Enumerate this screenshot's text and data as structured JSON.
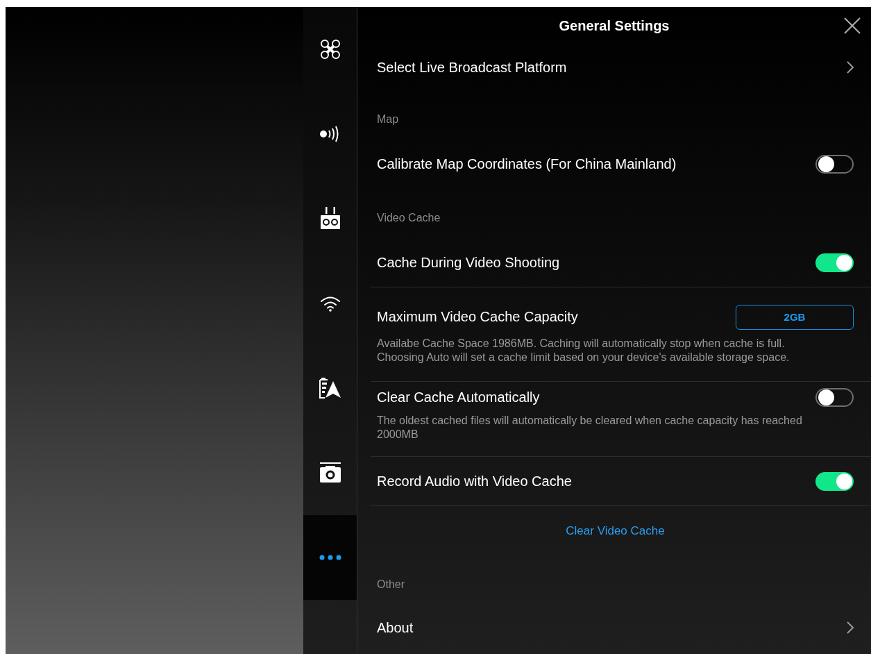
{
  "sidebar": {
    "items": [
      {
        "kind": "drone",
        "selected": false
      },
      {
        "kind": "transmission",
        "selected": false
      },
      {
        "kind": "controller",
        "selected": false
      },
      {
        "kind": "wifi",
        "selected": false
      },
      {
        "kind": "battery",
        "selected": false
      },
      {
        "kind": "camera",
        "selected": false
      },
      {
        "kind": "more",
        "selected": true
      }
    ]
  },
  "panel": {
    "title": "General Settings",
    "rows": [
      {
        "kind": "link",
        "label": "Select Live Broadcast Platform"
      },
      {
        "kind": "section",
        "label": "Map"
      },
      {
        "kind": "toggle",
        "label": "Calibrate Map Coordinates (For China Mainland)",
        "on": false
      },
      {
        "kind": "section",
        "label": "Video Cache"
      },
      {
        "kind": "toggle",
        "label": "Cache During Video Shooting",
        "on": true
      },
      {
        "kind": "value",
        "label": "Maximum Video Cache Capacity",
        "value": "2GB",
        "note": "Availabe Cache Space 1986MB. Caching will automatically stop when cache is full. Choosing Auto will set a cache limit based on your device's available storage space."
      },
      {
        "kind": "toggle",
        "label": "Clear Cache Automatically",
        "on": false,
        "note": "The oldest cached files will automatically be cleared when cache capacity has reached 2000MB"
      },
      {
        "kind": "toggle",
        "label": "Record Audio with Video Cache",
        "on": true
      },
      {
        "kind": "action",
        "label": "Clear Video Cache"
      },
      {
        "kind": "section",
        "label": "Other"
      },
      {
        "kind": "link",
        "label": "About"
      }
    ]
  }
}
